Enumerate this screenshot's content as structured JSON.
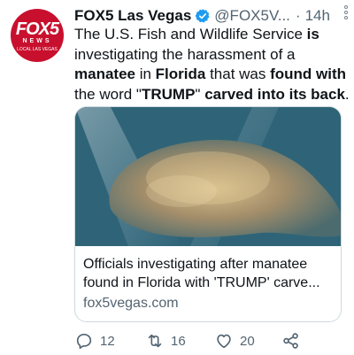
{
  "account": {
    "avatar_logo": "FOX5",
    "avatar_sub": "NEWS",
    "avatar_local": "LOCAL LAS VEGAS",
    "name": "FOX5 Las Vegas",
    "handle": "@FOX5V...",
    "separator": "·",
    "time": "14h"
  },
  "tweet": {
    "parts": [
      {
        "text": "The U.S. Fish and Wildlife Service ",
        "bold": false
      },
      {
        "text": "is",
        "bold": true
      },
      {
        "text": " investigating the harassment of a ",
        "bold": false
      },
      {
        "text": "manatee",
        "bold": true
      },
      {
        "text": " in ",
        "bold": false
      },
      {
        "text": "Florida",
        "bold": true
      },
      {
        "text": " that was ",
        "bold": false
      },
      {
        "text": "found with",
        "bold": true
      },
      {
        "text": " the word \"",
        "bold": false
      },
      {
        "text": "TRUMP",
        "bold": true
      },
      {
        "text": "\" ",
        "bold": false
      },
      {
        "text": "carved into its back",
        "bold": true
      },
      {
        "text": ".",
        "bold": false
      }
    ]
  },
  "card": {
    "title": "Officials investigating after manatee found in Florida with 'TRUMP' carve...",
    "domain": "fox5vegas.com"
  },
  "actions": {
    "replies": "12",
    "retweets": "16",
    "likes": "20"
  },
  "colors": {
    "brand_red": "#c8102e",
    "verified_blue": "#1d9bf0",
    "muted": "#536471"
  },
  "icons": [
    "verified-badge-icon",
    "more-icon",
    "reply-icon",
    "retweet-icon",
    "like-icon",
    "share-icon"
  ]
}
